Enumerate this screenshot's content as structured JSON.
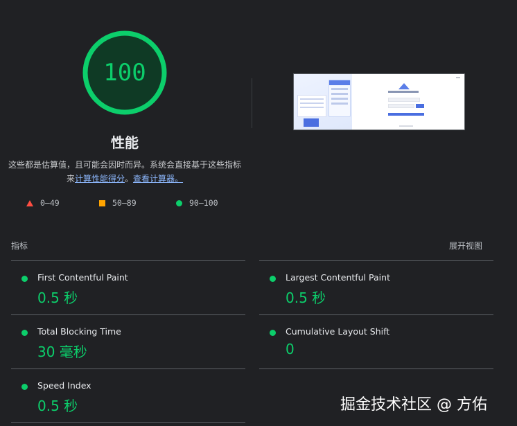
{
  "score": {
    "value": "100",
    "title": "性能",
    "description_prefix": "这些都是估算值，且可能会因时而异。系统会直接基于这些指标来",
    "calc_link": "计算性能得分",
    "separator": "。",
    "calculator_link": "查看计算器。",
    "color": "#0cce6b"
  },
  "legend": {
    "fail": "0–49",
    "average": "50–89",
    "pass": "90–100"
  },
  "metrics": {
    "title": "指标",
    "expand_label": "展开视图",
    "items": [
      {
        "name": "First Contentful Paint",
        "value": "0.5 秒"
      },
      {
        "name": "Largest Contentful Paint",
        "value": "0.5 秒"
      },
      {
        "name": "Total Blocking Time",
        "value": "30 毫秒"
      },
      {
        "name": "Cumulative Layout Shift",
        "value": "0"
      },
      {
        "name": "Speed Index",
        "value": "0.5 秒"
      }
    ]
  },
  "watermark": "掘金技术社区 @ 方佑"
}
